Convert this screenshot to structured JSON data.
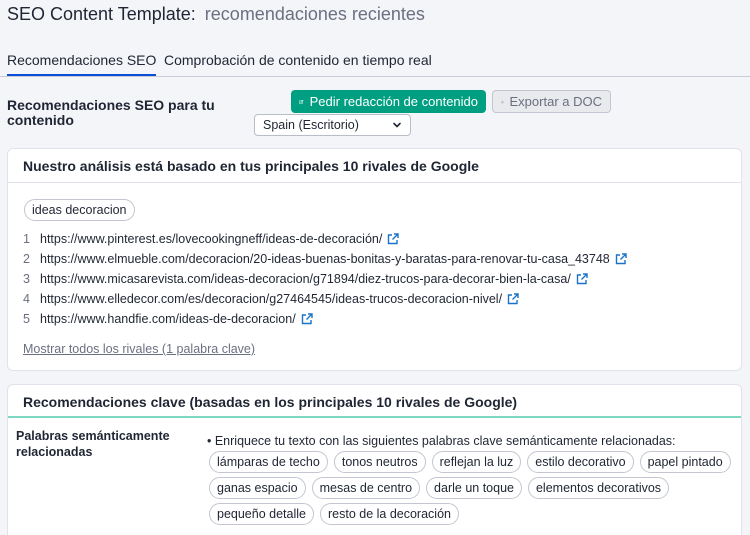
{
  "header": {
    "title": "SEO Content Template:",
    "subtitle": "recomendaciones recientes"
  },
  "tabs": [
    {
      "label": "Recomendaciones SEO",
      "active": true
    },
    {
      "label": "Comprobación de contenido en tiempo real",
      "active": false
    }
  ],
  "toolbar": {
    "heading": "Recomendaciones SEO para tu contenido",
    "order_label": "Pedir redacción de contenido",
    "export_label": "Exportar a DOC",
    "region_value": "Spain (Escritorio)"
  },
  "analysis": {
    "title": "Nuestro análisis está basado en tus principales 10 rivales de Google",
    "keyword": "ideas decoracion",
    "rivals": [
      {
        "num": "1",
        "url": "https://www.pinterest.es/lovecookingneff/ideas-de-decoración/"
      },
      {
        "num": "2",
        "url": "https://www.elmueble.com/decoracion/20-ideas-buenas-bonitas-y-baratas-para-renovar-tu-casa_43748"
      },
      {
        "num": "3",
        "url": "https://www.micasarevista.com/ideas-decoracion/g71894/diez-trucos-para-decorar-bien-la-casa/"
      },
      {
        "num": "4",
        "url": "https://www.elledecor.com/es/decoracion/g27464545/ideas-trucos-decoracion-nivel/"
      },
      {
        "num": "5",
        "url": "https://www.handfie.com/ideas-de-decoracion/"
      }
    ],
    "show_all": "Mostrar todos los rivales (1 palabra clave)"
  },
  "recommendations": {
    "title": "Recomendaciones clave (basadas en los principales 10 rivales de Google)",
    "semantic_label": "Palabras semánticamente relacionadas",
    "semantic_intro": "• Enriquece tu texto con las siguientes palabras clave semánticamente relacionadas:",
    "keywords": [
      [
        "lámparas de techo",
        "tonos neutros",
        "reflejan la luz",
        "estilo decorativo",
        "papel pintado"
      ],
      [
        "ganas espacio",
        "mesas de centro",
        "darle un toque",
        "elementos decorativos"
      ],
      [
        "pequeño detalle",
        "resto de la decoración"
      ]
    ]
  },
  "colors": {
    "primary_button": "#009f81",
    "active_tab_underline": "#0a4fd6",
    "external_link_icon": "#1a73c9",
    "section_divider": "#7ed7c1"
  },
  "icons": {
    "order": "edit-icon",
    "export": "export-icon",
    "dropdown": "chevron-down-icon",
    "rival_link": "external-link-icon"
  }
}
